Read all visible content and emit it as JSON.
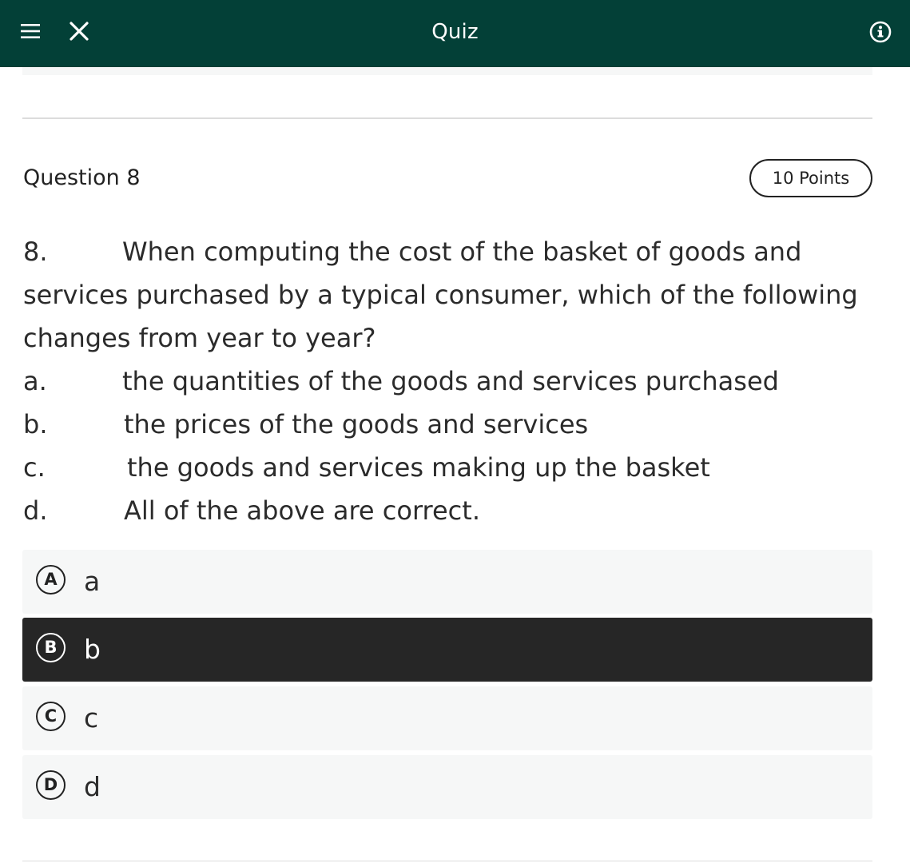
{
  "header": {
    "title": "Quiz",
    "menu_icon": "hamburger-menu-icon",
    "close_icon": "close-icon",
    "info_icon": "info-icon",
    "background_color": "#034037"
  },
  "question": {
    "label": "Question 8",
    "points": "10 Points",
    "number": "8.",
    "stem_line_1": "When computing the cost of the basket of goods and",
    "stem_line_2": "services purchased by a typical consumer, which of the following",
    "stem_line_3": "changes from year to year?",
    "options": [
      {
        "letter": "a.",
        "text": "the quantities of the goods and services purchased"
      },
      {
        "letter": "b.",
        "text": "the prices of the goods and services"
      },
      {
        "letter": "c.",
        "text": "the goods and services making up the basket"
      },
      {
        "letter": "d.",
        "text": "All of the above are correct."
      }
    ]
  },
  "answers": [
    {
      "badge": "A",
      "label": "a",
      "selected": false
    },
    {
      "badge": "B",
      "label": "b",
      "selected": true
    },
    {
      "badge": "C",
      "label": "c",
      "selected": false
    },
    {
      "badge": "D",
      "label": "d",
      "selected": false
    }
  ],
  "colors": {
    "selected_background": "#262626",
    "answer_background": "#f6f7f7"
  }
}
